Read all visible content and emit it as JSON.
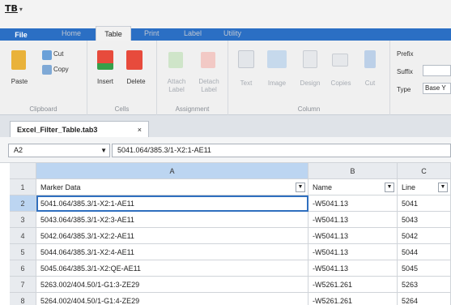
{
  "app": {
    "icon_text": "TB",
    "quick_access": "▾"
  },
  "ribbon_tabs": [
    {
      "label": "File"
    },
    {
      "label": "Home"
    },
    {
      "label": "Table"
    },
    {
      "label": "Print"
    },
    {
      "label": "Label"
    },
    {
      "label": "Utility"
    }
  ],
  "ribbon": {
    "clipboard": {
      "paste": "Paste",
      "cut": "Cut",
      "copy": "Copy",
      "group": "Clipboard"
    },
    "cells": {
      "insert": "Insert",
      "delete": "Delete",
      "group": "Cells"
    },
    "assignment": {
      "attach": "Attach\nLabel",
      "detach": "Detach\nLabel",
      "group": "Assignment"
    },
    "column": {
      "text": "Text",
      "image": "Image",
      "design": "Design",
      "copies": "Copies",
      "cut": "Cut",
      "group": "Column"
    },
    "right": {
      "prefix": "Prefix",
      "suffix": "Suffix",
      "type": "Type",
      "type_value": "Base Y"
    }
  },
  "document_tab": {
    "title": "Excel_Filter_Table.tab3",
    "close": "×"
  },
  "formula_bar": {
    "name_box": "A2",
    "formula": "5041.064/385.3/1-X2:1-AE11"
  },
  "columns": [
    "A",
    "B",
    "C"
  ],
  "header_row": {
    "num": "1",
    "a": "Marker Data",
    "b": "Name",
    "c": "Line"
  },
  "rows": [
    {
      "num": "2",
      "a": "5041.064/385.3/1-X2:1-AE11",
      "b": "-W5041.13",
      "c": "5041"
    },
    {
      "num": "3",
      "a": "5043.064/385.3/1-X2:3-AE11",
      "b": "-W5041.13",
      "c": "5043"
    },
    {
      "num": "4",
      "a": "5042.064/385.3/1-X2:2-AE11",
      "b": "-W5041.13",
      "c": "5042"
    },
    {
      "num": "5",
      "a": "5044.064/385.3/1-X2:4-AE11",
      "b": "-W5041.13",
      "c": "5044"
    },
    {
      "num": "6",
      "a": "5045.064/385.3/1-X2:QE-AE11",
      "b": "-W5041.13",
      "c": "5045"
    },
    {
      "num": "7",
      "a": "5263.002/404.50/1-G1:3-ZE29",
      "b": "-W5261.261",
      "c": "5263"
    },
    {
      "num": "8",
      "a": "5264.002/404.50/1-G1:4-ZE29",
      "b": "-W5261.261",
      "c": "5264"
    }
  ],
  "colors": {
    "accent": "#2b6fc4",
    "selection": "#bcd5f1"
  }
}
